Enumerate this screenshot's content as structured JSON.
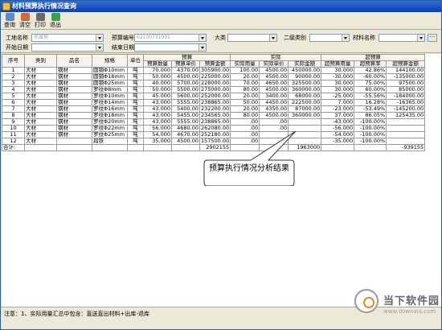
{
  "window": {
    "title": "材料预算执行情况查询"
  },
  "toolbar": {
    "buttons": [
      {
        "label": "查询"
      },
      {
        "label": "清空"
      },
      {
        "label": "打印"
      },
      {
        "label": "退出"
      }
    ]
  },
  "filters": {
    "site_name_label": "工地名称",
    "site_name_value": "东城苑",
    "budget_no_label": "预算编号",
    "budget_no_value": "02100731001",
    "category_label": "大类",
    "category_value": "",
    "subcategory_label": "二级类别",
    "subcategory_value": "",
    "material_label": "材料名称",
    "material_value": "",
    "start_date_label": "开始日期",
    "start_date_value": "",
    "end_date_label": "结束日期",
    "end_date_value": "",
    "ellipsis": "···"
  },
  "grid": {
    "group_headers": {
      "budget": "预算",
      "actual": "实际",
      "over": "超预算"
    },
    "columns": {
      "seq": "序号",
      "type": "类别",
      "name": "品名",
      "spec": "规格",
      "unit": "单位",
      "budget_qty": "预算数量",
      "budget_price": "预算单价",
      "budget_amount": "预算金额",
      "actual_qty": "实际用量",
      "actual_price": "实际单价",
      "actual_amount": "实际金额",
      "over_qty": "超预算用量",
      "over_rate": "超预算率",
      "over_amount": "超预算金额"
    },
    "rows": [
      [
        "1",
        "大材",
        "钢材",
        "圆钢Φ10mm",
        "吨",
        "70.000",
        "4370.00",
        "305900.00",
        "100.00",
        "4500.00",
        "450000.00",
        "30.000",
        "42.86%",
        "144100.00"
      ],
      [
        "2",
        "大材",
        "钢材",
        "圆钢Φ18mm",
        "吨",
        "50.000",
        "4500.00",
        "225000.00",
        "20.00",
        "4500.00",
        "90000.00",
        "-30.000",
        "-60.00%",
        "-135000.00"
      ],
      [
        "3",
        "大材",
        "钢材",
        "圆钢Φ25mm",
        "吨",
        "40.000",
        "5700.00",
        "228000.00",
        "70.00",
        "4650.00",
        "325500.00",
        "30.000",
        "75.00%",
        "97500.00"
      ],
      [
        "4",
        "大材",
        "钢材",
        "罗纹Φ8mm",
        "吨",
        "50.000",
        "5500.00",
        "275000.00",
        "80.00",
        "4500.00",
        "360000.00",
        "30.000",
        "60.00%",
        "85000.00"
      ],
      [
        "5",
        "大材",
        "钢材",
        "罗纹Φ10mm",
        "吨",
        "45.000",
        "5600.00",
        "252000.00",
        "20.00",
        "3400.00",
        "68000.00",
        "-25.000",
        "-55.56%",
        "-184000.00"
      ],
      [
        "6",
        "大材",
        "钢材",
        "罗纹Φ14mm",
        "吨",
        "43.000",
        "5555.00",
        "238865.00",
        "50.00",
        "4450.00",
        "222500.00",
        "7.000",
        "16.28%",
        "-16365.00"
      ],
      [
        "7",
        "大材",
        "钢材",
        "罗纹Φ16mm",
        "吨",
        "43.000",
        "5400.00",
        "232200.00",
        "20.00",
        "4350.00",
        "87000.00",
        "-23.000",
        "-53.49%",
        "-145200.00"
      ],
      [
        "8",
        "大材",
        "钢材",
        "罗纹Φ18mm",
        "吨",
        "43.000",
        "5455.00",
        "234565.00",
        "80.00",
        "4500.00",
        "360000.00",
        "37.000",
        "86.05%",
        "125435.00"
      ],
      [
        "9",
        "大材",
        "钢材",
        "罗纹Φ20mm",
        "吨",
        "43.000",
        "5555.00",
        "238865.00",
        ".00",
        ".00",
        "",
        "-43.000",
        "-100.00%",
        ""
      ],
      [
        "10",
        "大材",
        "钢材",
        "罗纹Φ22mm",
        "吨",
        "56.000",
        "4680.00",
        "262080.00",
        ".00",
        ".00",
        "",
        "-56.000",
        "-100.00%",
        ""
      ],
      [
        "11",
        "大材",
        "钢材",
        "罗纹Φ25mm",
        "吨",
        "54.000",
        "4670.00",
        "252180.00",
        ".00",
        "",
        "",
        "-54.000",
        "-100.00%",
        ""
      ],
      [
        "12",
        "大材",
        "",
        "扁铁",
        "吨",
        "35.000",
        "4500.00",
        "157500.00",
        ".00",
        "",
        "",
        "-35.000",
        "-100.00%",
        ""
      ]
    ],
    "totals": {
      "label": "合计:",
      "budget_amount": "2902155",
      "actual_amount": "1963000",
      "over_amount": "-939155"
    }
  },
  "callout": {
    "text": "预算执行情况分析结果"
  },
  "status": {
    "note": "注意：1、实际用量汇总中包含：直送直出材料+出库-退库"
  },
  "watermark": {
    "title": "当下软件园",
    "url": "www.downxia.com"
  },
  "colors": {
    "titlebar": "#0a3fb0",
    "window_bg": "#ece9d8",
    "grid_border": "#9a9a9a"
  }
}
